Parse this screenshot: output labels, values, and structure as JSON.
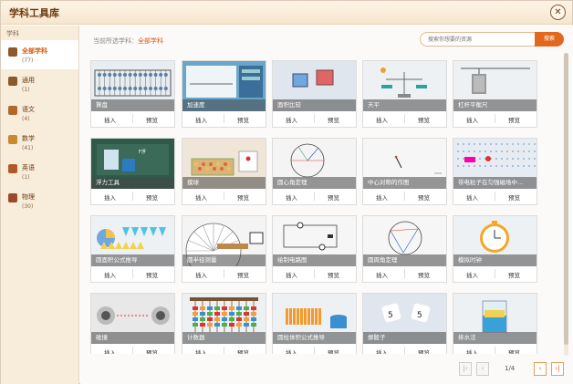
{
  "window": {
    "title": "学科工具库",
    "close_icon": "close-icon"
  },
  "sidebar": {
    "header": "学科",
    "items": [
      {
        "label": "全部学科",
        "count": "(77)",
        "icon": "grid-icon",
        "color": "#8a5a2b",
        "active": true
      },
      {
        "label": "通用",
        "count": "(1)",
        "icon": "book-icon",
        "color": "#8a5a2b"
      },
      {
        "label": "语文",
        "count": "(4)",
        "icon": "pen-icon",
        "color": "#b0692a"
      },
      {
        "label": "数学",
        "count": "(41)",
        "icon": "abacus-icon",
        "color": "#c98a2e"
      },
      {
        "label": "英语",
        "count": "(1)",
        "icon": "globe-icon",
        "color": "#b05a2a"
      },
      {
        "label": "物理",
        "count": "(30)",
        "icon": "magnet-icon",
        "color": "#9a4a2a"
      }
    ]
  },
  "breadcrumb": {
    "prefix": "当前所选学科：",
    "current": "全部学科"
  },
  "search": {
    "placeholder": "搜索你想要的资源",
    "button": "搜索"
  },
  "actions": {
    "insert": "插入",
    "preview": "预览"
  },
  "tools": [
    "算盘",
    "加速度",
    "面积比较",
    "天平",
    "杠杆平衡尺",
    "浮力工具",
    "摸球",
    "圆心角定理",
    "中心对称的作图",
    "带电粒子在匀强磁场中...",
    "圆面积公式推导",
    "圆半径测量",
    "绘制电路图",
    "圆周角定理",
    "模拟时钟",
    "碰撞",
    "计数器",
    "圆柱体积公式推导",
    "掷骰子",
    "排水法"
  ],
  "pager": {
    "text": "1/4",
    "first": "|‹",
    "prev": "‹",
    "next": "›",
    "last": "›|"
  },
  "colors": {
    "accent": "#e2681e",
    "brand": "#6b3a0c",
    "thumb_bg": "#dfe6ee"
  }
}
